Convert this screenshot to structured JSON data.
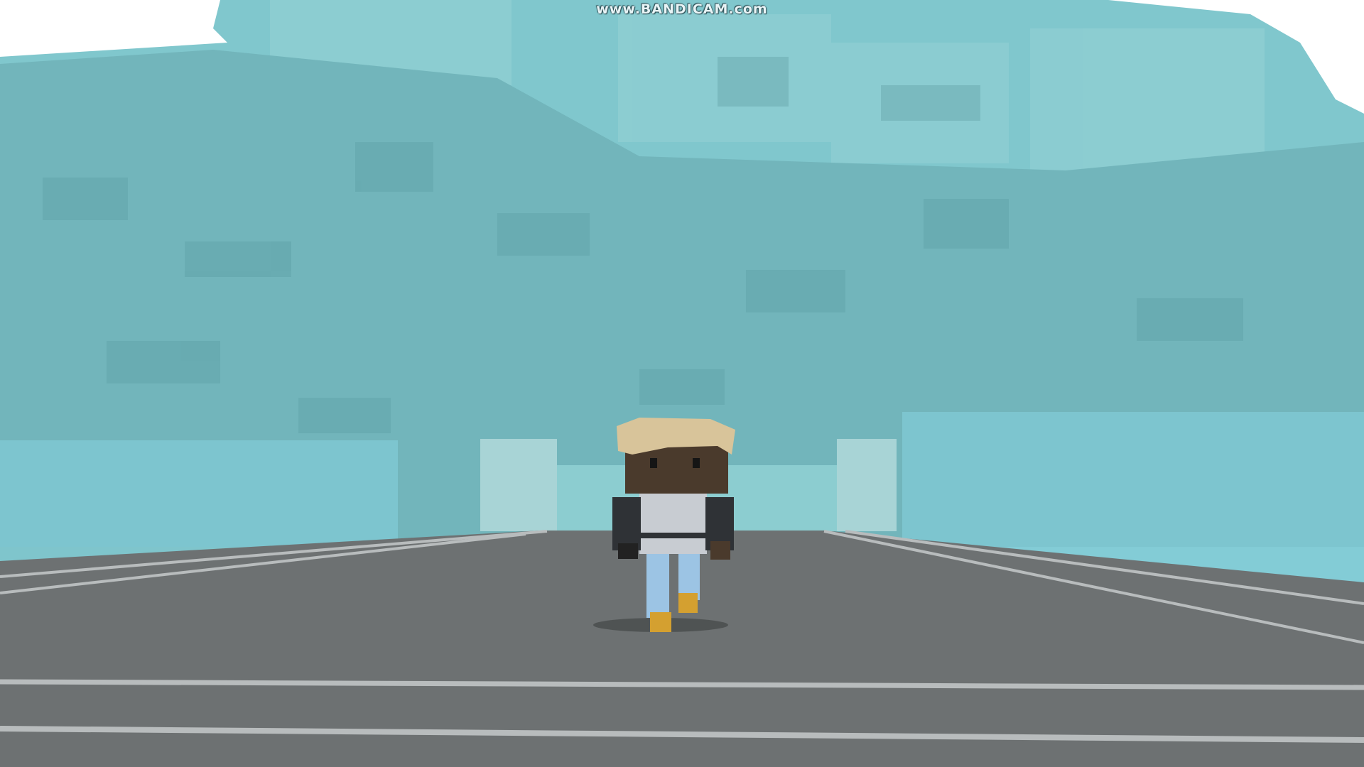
{
  "watermark": {
    "text": "www.BANDICAM.com"
  },
  "colors": {
    "fog": "#7fc5cc",
    "cliff": "#72b6bc",
    "road": "#6d7172",
    "road_line": "#b8bcbd",
    "sky": "#ffffff",
    "hair": "#d8c49a",
    "skin": "#4a3a2c",
    "shirt": "#c8ccd2",
    "jacket": "#2f3236",
    "jeans": "#9cc4e4",
    "boots": "#d4a030"
  }
}
